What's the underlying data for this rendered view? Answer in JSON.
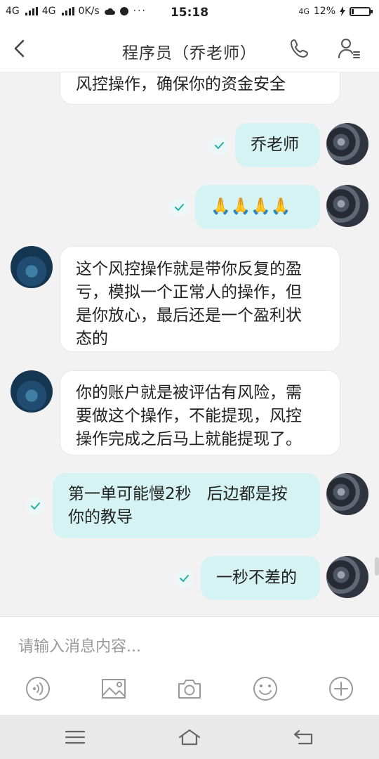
{
  "status_bar": {
    "net1": "4G",
    "net2": "4G",
    "speed": "0K/s",
    "time": "15:18",
    "net3": "4G",
    "battery_percent": "12%",
    "battery_level": 0.12
  },
  "header": {
    "title": "程序员（乔老师）",
    "icons": {
      "back": "back-chevron-icon",
      "call": "phone-icon",
      "profile": "profile-icon"
    }
  },
  "messages": [
    {
      "side": "in",
      "lines": [
        "风控操作，确保你的资金安全"
      ]
    },
    {
      "side": "out",
      "lines": [
        "乔老师"
      ],
      "read": true
    },
    {
      "side": "out",
      "lines": [
        "🙏🙏🙏🙏"
      ],
      "read": true
    },
    {
      "side": "in",
      "lines": [
        "这个风控操作就是带你反复的盈",
        "亏，模拟一个正常人的操作，但",
        "是你放心，最后还是一个盈利状",
        "态的"
      ]
    },
    {
      "side": "in",
      "lines": [
        "你的账户就是被评估有风险，需",
        "要做这个操作，不能提现，风控",
        "操作完成之后马上就能提现了。"
      ]
    },
    {
      "side": "out",
      "lines": [
        "第一单可能慢2秒   后边都是按",
        "你的教导"
      ],
      "read": true
    },
    {
      "side": "out",
      "lines": [
        "一秒不差的"
      ],
      "read": true
    }
  ],
  "input": {
    "placeholder": "请输入消息内容...",
    "tools": [
      "voice-icon",
      "image-icon",
      "camera-icon",
      "emoji-icon",
      "plus-icon"
    ]
  },
  "colors": {
    "outgoing_bubble": "#d6f3f3",
    "incoming_bubble": "#ffffff",
    "check": "#25b0a6"
  }
}
